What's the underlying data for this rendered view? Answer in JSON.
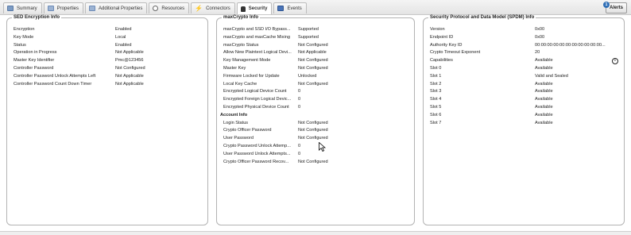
{
  "tabs": [
    {
      "label": "Summary",
      "icon": "summary-icon"
    },
    {
      "label": "Properties",
      "icon": "properties-icon"
    },
    {
      "label": "Additional Properties",
      "icon": "additional-properties-icon"
    },
    {
      "label": "Resources",
      "icon": "search-icon"
    },
    {
      "label": "Connectors",
      "icon": "connector-icon"
    },
    {
      "label": "Security",
      "icon": "lock-icon",
      "active": true
    },
    {
      "label": "Events",
      "icon": "events-icon"
    }
  ],
  "alerts": {
    "label": "Alerts",
    "count": "1"
  },
  "sed": {
    "title": "SED Encryption Info",
    "rows": [
      {
        "k": "Encryption",
        "v": "Enabled"
      },
      {
        "k": "Key Mode",
        "v": "Local"
      },
      {
        "k": "Status",
        "v": "Enabled"
      },
      {
        "k": "Operation in Progress",
        "v": "Not Applicable"
      },
      {
        "k": "Master Key Identifier",
        "v": "Pmc@123456"
      },
      {
        "k": "Controller Password",
        "v": "Not Configured"
      },
      {
        "k": "Controller Password Unlock Attempts Left",
        "v": "Not Applicable"
      },
      {
        "k": "Controller Password Count Down Timer",
        "v": "Not Applicable"
      }
    ]
  },
  "maxcrypto": {
    "title": "maxCrypto Info",
    "rows": [
      {
        "k": "maxCrypto and SSD I/O Bypass...",
        "v": "Supported"
      },
      {
        "k": "maxCrypto and maxCache Mixing",
        "v": "Supported"
      },
      {
        "k": "maxCrypto Status",
        "v": "Not Configured"
      },
      {
        "k": "Allow New Plaintext Logical Devi...",
        "v": "Not Applicable"
      },
      {
        "k": "Key Management Mode",
        "v": "Not Configured"
      },
      {
        "k": "Master Key",
        "v": "Not Configured"
      },
      {
        "k": "Firmware Locked for Update",
        "v": "Unlocked"
      },
      {
        "k": "Local Key Cache",
        "v": "Not Configured"
      },
      {
        "k": "Encrypted Logical Device Count",
        "v": "0"
      },
      {
        "k": "Encrypted Foreign Logical Devic...",
        "v": "0"
      },
      {
        "k": "Encrypted Physical Device Count",
        "v": "0"
      }
    ],
    "account_title": "Account Info",
    "account_rows": [
      {
        "k": "Login Status",
        "v": "Not Configured"
      },
      {
        "k": "Crypto Officer Password",
        "v": "Not Configured"
      },
      {
        "k": "User Password",
        "v": "Not Configured"
      },
      {
        "k": "Crypto Password Unlock Attemp...",
        "v": "0"
      },
      {
        "k": "User Password Unlock Attempts...",
        "v": "0"
      },
      {
        "k": "Crypto Officer Password Recov...",
        "v": "Not Configured"
      }
    ]
  },
  "spdm": {
    "title": "Security Protocol and Data Model (SPDM) Info",
    "rows": [
      {
        "k": "Version",
        "v": "0x00"
      },
      {
        "k": "Endpoint ID",
        "v": "0x00"
      },
      {
        "k": "Authority Key ID",
        "v": "00:00:00:00:00:00:00:00:00:00:00..."
      },
      {
        "k": "Crypto Timeout Exponent",
        "v": "20"
      },
      {
        "k": "Capabilities",
        "v": "Available"
      },
      {
        "k": "Slot 0",
        "v": "Available"
      },
      {
        "k": "Slot 1",
        "v": "Valid and Sealed"
      },
      {
        "k": "Slot 2",
        "v": "Available"
      },
      {
        "k": "Slot 3",
        "v": "Available"
      },
      {
        "k": "Slot 4",
        "v": "Available"
      },
      {
        "k": "Slot 5",
        "v": "Available"
      },
      {
        "k": "Slot 6",
        "v": "Available"
      },
      {
        "k": "Slot 7",
        "v": "Available"
      }
    ]
  }
}
